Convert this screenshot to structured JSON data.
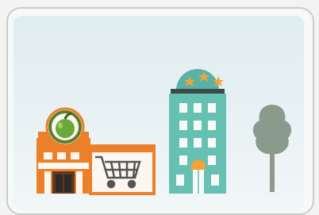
{
  "scene": {
    "colors": {
      "store_orange": "#ec7f2a",
      "store_wall": "#fbf6ef",
      "apple_green": "#6aa83a",
      "hotel_teal": "#67c1b3",
      "hotel_dome": "#5ab2a6",
      "star_orange": "#f2a33a",
      "tree_gray": "#8a9b8e",
      "window_white": "#f5f9f8"
    },
    "icons": [
      "grocery-store-icon",
      "apple-icon",
      "shopping-cart-icon",
      "hotel-icon",
      "star-icon",
      "tree-icon"
    ],
    "hotel_stars": 3
  }
}
